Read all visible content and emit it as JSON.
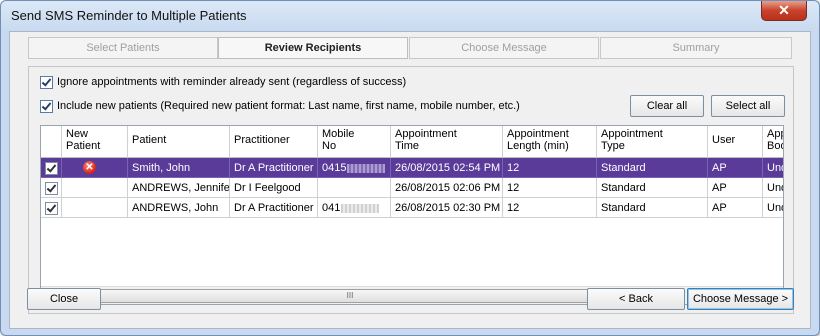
{
  "window": {
    "title": "Send SMS Reminder to Multiple Patients",
    "close_glyph": "✕"
  },
  "wizard": {
    "steps": [
      {
        "label": "Select Patients",
        "state": "disabled"
      },
      {
        "label": "Review Recipients",
        "state": "active"
      },
      {
        "label": "Choose Message",
        "state": "disabled"
      },
      {
        "label": "Summary",
        "state": "disabled"
      }
    ]
  },
  "options": {
    "ignore_sent": {
      "label": "Ignore appointments with reminder already sent (regardless of success)",
      "checked": true
    },
    "include_new": {
      "label": "Include new patients (Required new patient format: Last name, first name, mobile number, etc.)",
      "checked": true
    }
  },
  "actions": {
    "clear_all": "Clear all",
    "select_all": "Select all"
  },
  "grid": {
    "columns": [
      {
        "label": "",
        "line2": ""
      },
      {
        "label": "New",
        "line2": "Patient"
      },
      {
        "label": "Patient",
        "line2": ""
      },
      {
        "label": "Practitioner",
        "line2": ""
      },
      {
        "label": "Mobile",
        "line2": "No"
      },
      {
        "label": "Appointment",
        "line2": "Time"
      },
      {
        "label": "Appointment",
        "line2": "Length (min)"
      },
      {
        "label": "Appointment",
        "line2": "Type"
      },
      {
        "label": "User",
        "line2": ""
      },
      {
        "label": "App",
        "line2": "Boo"
      }
    ],
    "rows": [
      {
        "checked": true,
        "new_patient_error": true,
        "patient": "Smith, John",
        "practitioner": "Dr A Practitioner",
        "mobile": "0415",
        "time": "26/08/2015 02:54 PM",
        "length": "12",
        "type": "Standard",
        "user": "AP",
        "booked": "Und",
        "selected": true
      },
      {
        "checked": true,
        "new_patient_error": false,
        "patient": "ANDREWS, Jennifer",
        "practitioner": "Dr I Feelgood",
        "mobile": "",
        "time": "26/08/2015 02:06 PM",
        "length": "12",
        "type": "Standard",
        "user": "AP",
        "booked": "Und",
        "selected": false
      },
      {
        "checked": true,
        "new_patient_error": false,
        "patient": "ANDREWS, John",
        "practitioner": "Dr A Practitioner",
        "mobile": "041",
        "time": "26/08/2015 02:30 PM",
        "length": "12",
        "type": "Standard",
        "user": "AP",
        "booked": "Und",
        "selected": false
      }
    ],
    "scroll": {
      "left_arrow": "◀",
      "right_arrow": "▶",
      "grip": "III"
    }
  },
  "footer": {
    "close": "Close",
    "back": "< Back",
    "next": "Choose Message >"
  }
}
